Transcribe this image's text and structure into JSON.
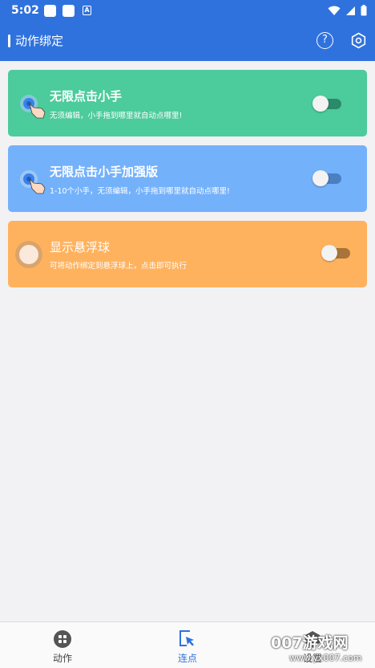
{
  "status_bar": {
    "time": "5:02"
  },
  "app_bar": {
    "title": "动作绑定"
  },
  "cards": [
    {
      "title": "无限点击小手",
      "desc": "无须编辑，小手拖到哪里就自动点哪里!",
      "color": "#4ccb9c",
      "enabled": false
    },
    {
      "title": "无限点击小手加强版",
      "desc": "1-10个小手，无须编辑，小手拖到哪里就自动点哪里!",
      "color": "#74b1fb",
      "enabled": false
    },
    {
      "title": "显示悬浮球",
      "desc": "可将动作绑定到悬浮球上，点击即可执行",
      "color": "#ffb25e",
      "enabled": false
    }
  ],
  "bottom_nav": {
    "items": [
      {
        "label": "动作",
        "active": false
      },
      {
        "label": "连点",
        "active": true
      },
      {
        "label": "设置",
        "active": false
      }
    ],
    "active_color": "#2f72de"
  },
  "watermark": {
    "text": "007游戏网",
    "url": "www.yx007.com"
  }
}
